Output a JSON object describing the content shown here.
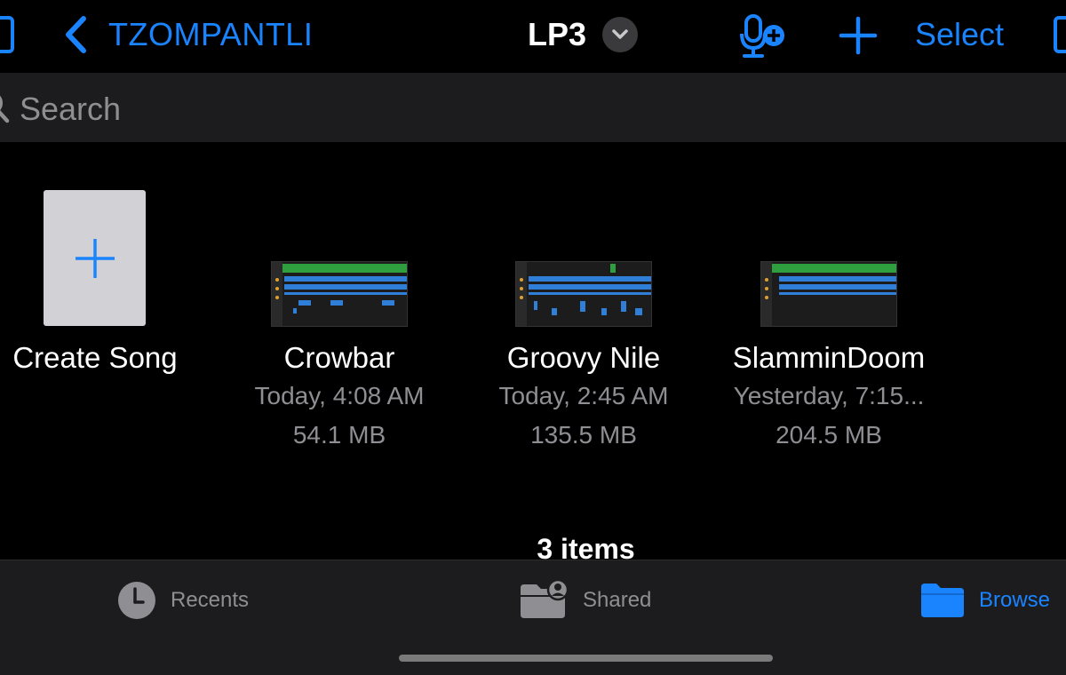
{
  "nav": {
    "back_label": "TZOMPANTLI",
    "title": "LP3",
    "select_label": "Select"
  },
  "search": {
    "placeholder": "Search"
  },
  "create_song": {
    "label": "Create Song"
  },
  "songs": [
    {
      "name": "Crowbar",
      "date": "Today, 4:08 AM",
      "size": "54.1 MB"
    },
    {
      "name": "Groovy Nile",
      "date": "Today, 2:45 AM",
      "size": "135.5 MB"
    },
    {
      "name": "SlamminDoom",
      "date": "Yesterday, 7:15...",
      "size": "204.5 MB"
    }
  ],
  "item_count": "3 items",
  "tabs": [
    {
      "label": "Recents",
      "icon": "clock-icon"
    },
    {
      "label": "Shared",
      "icon": "shared-folder-icon"
    },
    {
      "label": "Browse",
      "icon": "folder-icon"
    }
  ],
  "colors": {
    "accent": "#1a84ff",
    "background": "#000000",
    "bar": "#1c1c1e",
    "secondary_text": "#8e8e93"
  }
}
